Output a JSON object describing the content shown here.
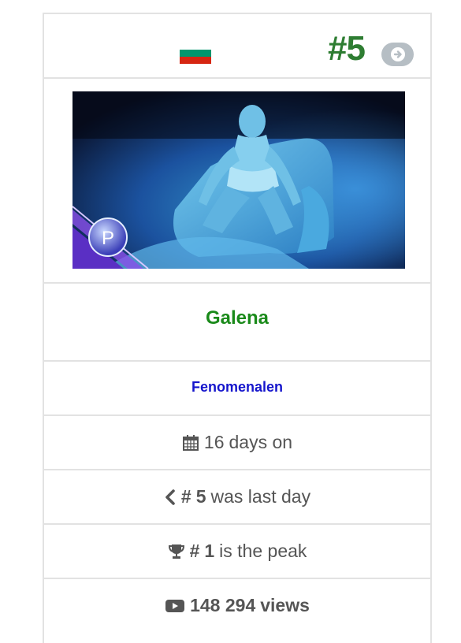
{
  "entry": {
    "rank": "#5",
    "artist": "Galena",
    "song": "Fenomenalen",
    "flag_colors": [
      "#ffffff",
      "#00966e",
      "#d62612"
    ],
    "thumbnail_badge": "P"
  },
  "stats": {
    "days_value": "16",
    "days_text": "days on",
    "last_prefix": "#",
    "last_value": "5",
    "last_text": "was last day",
    "peak_prefix": "#",
    "peak_value": "1",
    "peak_text": "is the peak",
    "views_value": "148 294",
    "views_text": "views"
  },
  "icons": {
    "next": "arrow-circle-right-icon",
    "days": "calendar-icon",
    "last": "chevron-left-icon",
    "peak": "trophy-icon",
    "views": "youtube-play-icon"
  },
  "colors": {
    "rank": "#2e7d32",
    "artist": "#1a8a1a",
    "song": "#1515cc",
    "stat_text": "#555555",
    "border": "#e2e2e2"
  }
}
